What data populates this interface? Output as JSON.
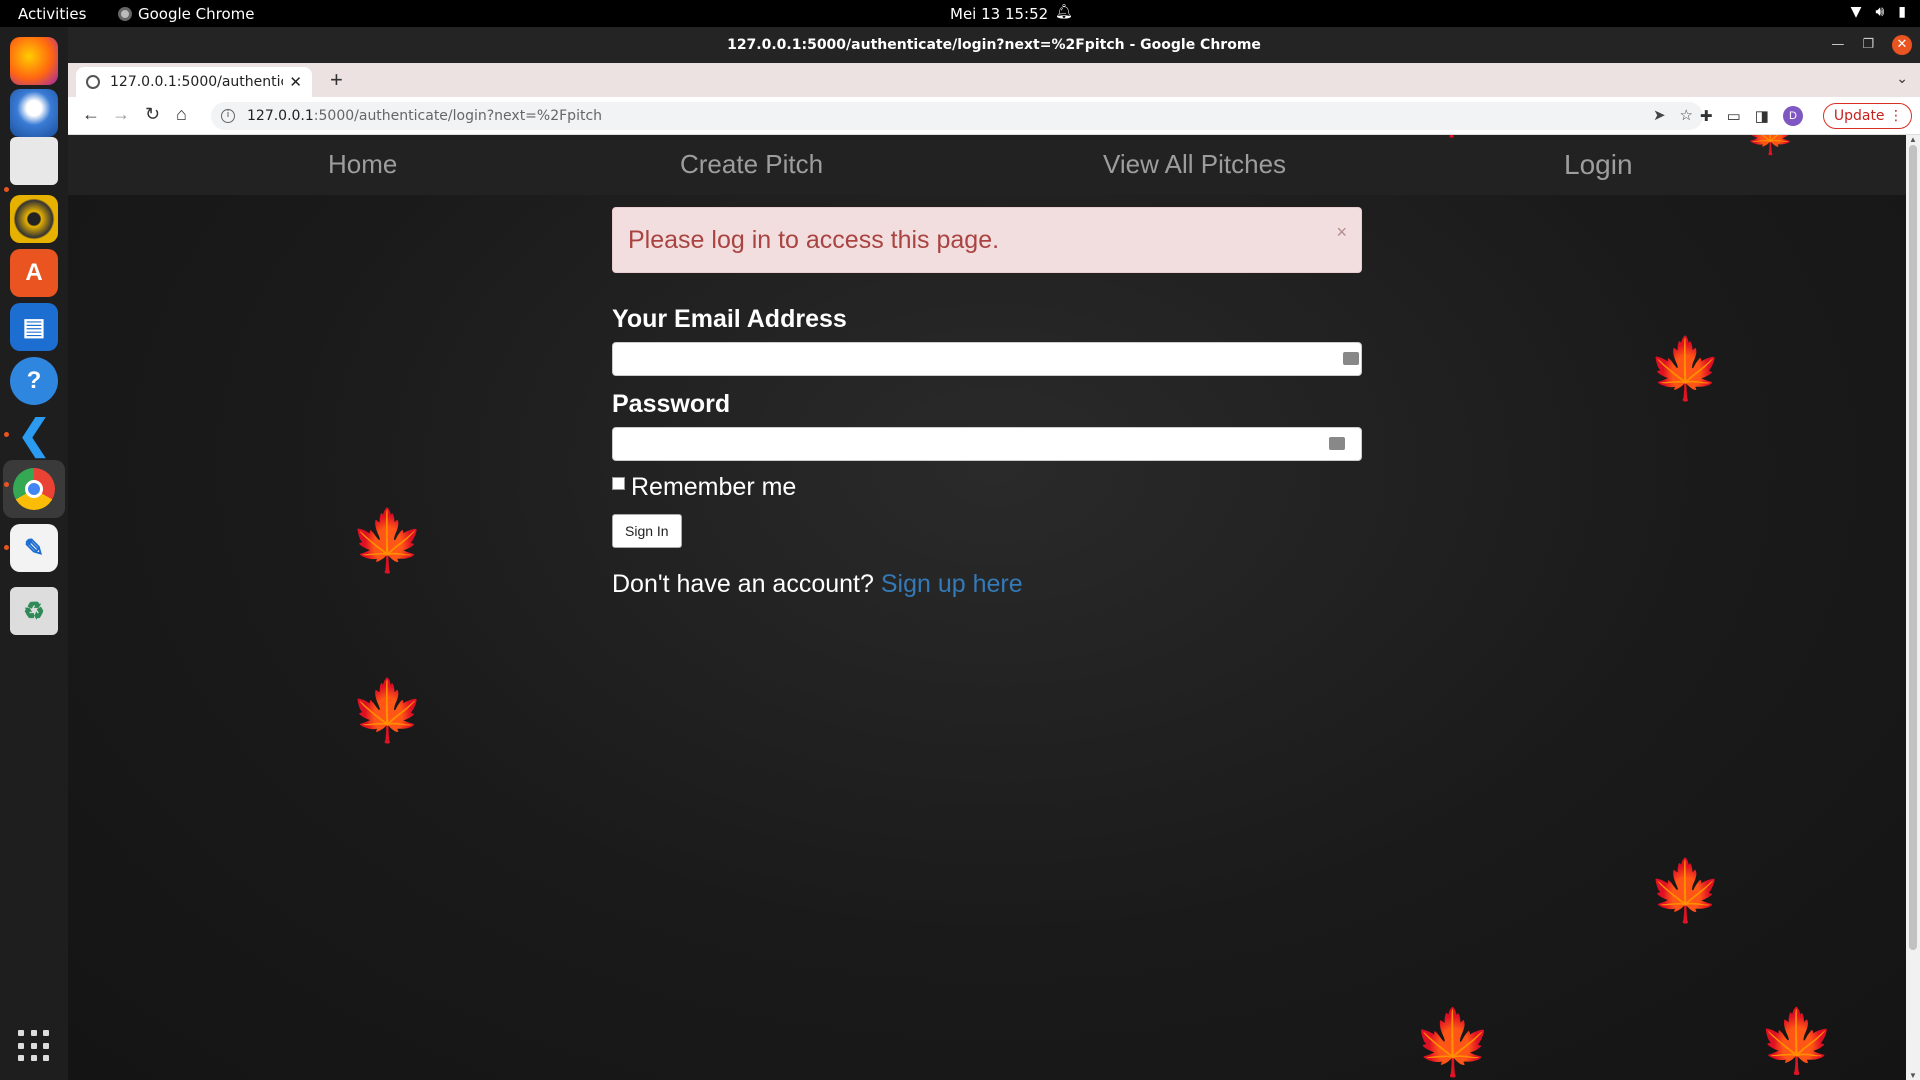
{
  "os": {
    "activities": "Activities",
    "app_name": "Google Chrome",
    "clock": "Mei 13  15:52"
  },
  "browser": {
    "window_title": "127.0.0.1:5000/authenticate/login?next=%2Fpitch - Google Chrome",
    "tab_title": "127.0.0.1:5000/authenticate/login?next=%2Fpitch",
    "url_host": "127.0.0.1",
    "url_path": ":5000/authenticate/login?next=%2Fpitch",
    "update_label": "Update",
    "profile_initial": "D"
  },
  "nav": {
    "home": "Home",
    "create_pitch": "Create Pitch",
    "view_all": "View All Pitches",
    "login": "Login"
  },
  "alert": {
    "message": "Please log in to access this page.",
    "close": "×"
  },
  "form": {
    "email_label": "Your Email Address",
    "email_value": "",
    "password_label": "Password",
    "password_value": "",
    "remember_label": "Remember me",
    "remember_checked": false,
    "submit_label": "Sign In"
  },
  "footer": {
    "prompt": "Don't have an account?",
    "signup_link": "Sign up here"
  },
  "colors": {
    "alert_bg": "#f2dede",
    "alert_text": "#a94442",
    "link": "#337ab7",
    "nav_bg": "#222222",
    "nav_text": "#9d9d9d",
    "ubuntu_accent": "#e95420"
  }
}
